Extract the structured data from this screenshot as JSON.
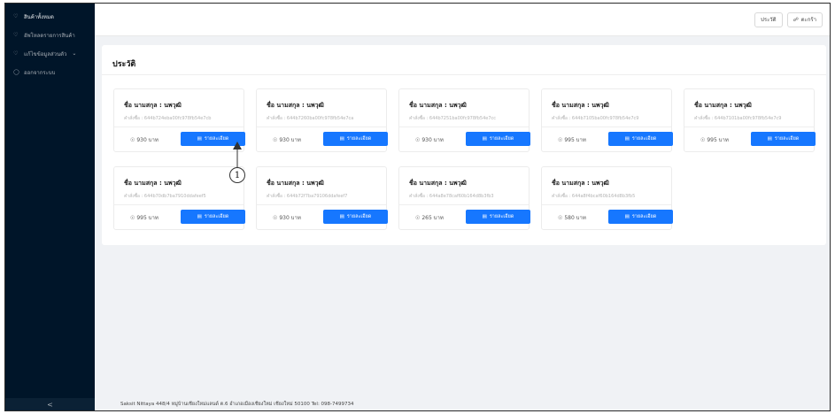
{
  "sidebar": {
    "items": [
      {
        "icon": "user-icon",
        "label": "สินค้าทั้งหมด"
      },
      {
        "icon": "user-icon",
        "label": "อัพโหลดรายการสินค้า"
      },
      {
        "icon": "user-icon",
        "label": "แก้ไขข้อมูลส่วนตัว"
      },
      {
        "icon": "logout-icon",
        "label": "ออกจากระบบ"
      }
    ],
    "collapse_label": "<"
  },
  "topbar": {
    "history_label": "ประวัติ",
    "cart_label": "ตะกร้า"
  },
  "panel": {
    "title": "ประวัติ"
  },
  "cards": [
    {
      "title": "ชื่อ นามสกุล : นพวุฒิ",
      "order_id": "คำสั่งซื้อ : 644b724eba00fc978fb54e7cb",
      "price": "930 บาท",
      "button_label": "รายละเอียด"
    },
    {
      "title": "ชื่อ นามสกุล : นพวุฒิ",
      "order_id": "คำสั่งซื้อ : 644b7260ba00fc978fb54e7ca",
      "price": "930 บาท",
      "button_label": "รายละเอียด"
    },
    {
      "title": "ชื่อ นามสกุล : นพวุฒิ",
      "order_id": "คำสั่งซื้อ : 644b7251ba00fc978fb54e7cc",
      "price": "930 บาท",
      "button_label": "รายละเอียด"
    },
    {
      "title": "ชื่อ นามสกุล : นพวุฒิ",
      "order_id": "คำสั่งซื้อ : 644b7105ba00fc978fb54e7c9",
      "price": "995 บาท",
      "button_label": "รายละเอียด"
    },
    {
      "title": "ชื่อ นามสกุล : นพวุฒิ",
      "order_id": "คำสั่งซื้อ : 644b7101ba00fc978fb54e7c9",
      "price": "995 บาท",
      "button_label": "รายละเอียด"
    },
    {
      "title": "ชื่อ นามสกุล : นพวุฒิ",
      "order_id": "คำสั่งซื้อ : 644b70db7ba7910ddafeef5",
      "price": "995 บาท",
      "button_label": "รายละเอียด"
    },
    {
      "title": "ชื่อ นามสกุล : นพวุฒิ",
      "order_id": "คำสั่งซื้อ : 644b72f7ba79106ddafeef7",
      "price": "930 บาท",
      "button_label": "รายละเอียด"
    },
    {
      "title": "ชื่อ นามสกุล : นพวุฒิ",
      "order_id": "คำสั่งซื้อ : 644a8e78caf60b164d8b3fb3",
      "price": "265 บาท",
      "button_label": "รายละเอียด"
    },
    {
      "title": "ชื่อ นามสกุล : นพวุฒิ",
      "order_id": "คำสั่งซื้อ : 644a8f4bcaf60b164d8b3fb5",
      "price": "580 บาท",
      "button_label": "รายละเอียด"
    }
  ],
  "footer": {
    "text": "Saksit Nittaya 448/4 หมู่บ้านเชียงใหม่แลนด์ ต.6 อำเภอเมืองเชียงใหม่ เชียงใหม่ 50100 Tel: 098-7499734"
  },
  "callout": {
    "number": "1"
  },
  "colors": {
    "sidebar": "#001529",
    "primary": "#1677ff",
    "background": "#f0f2f5"
  }
}
